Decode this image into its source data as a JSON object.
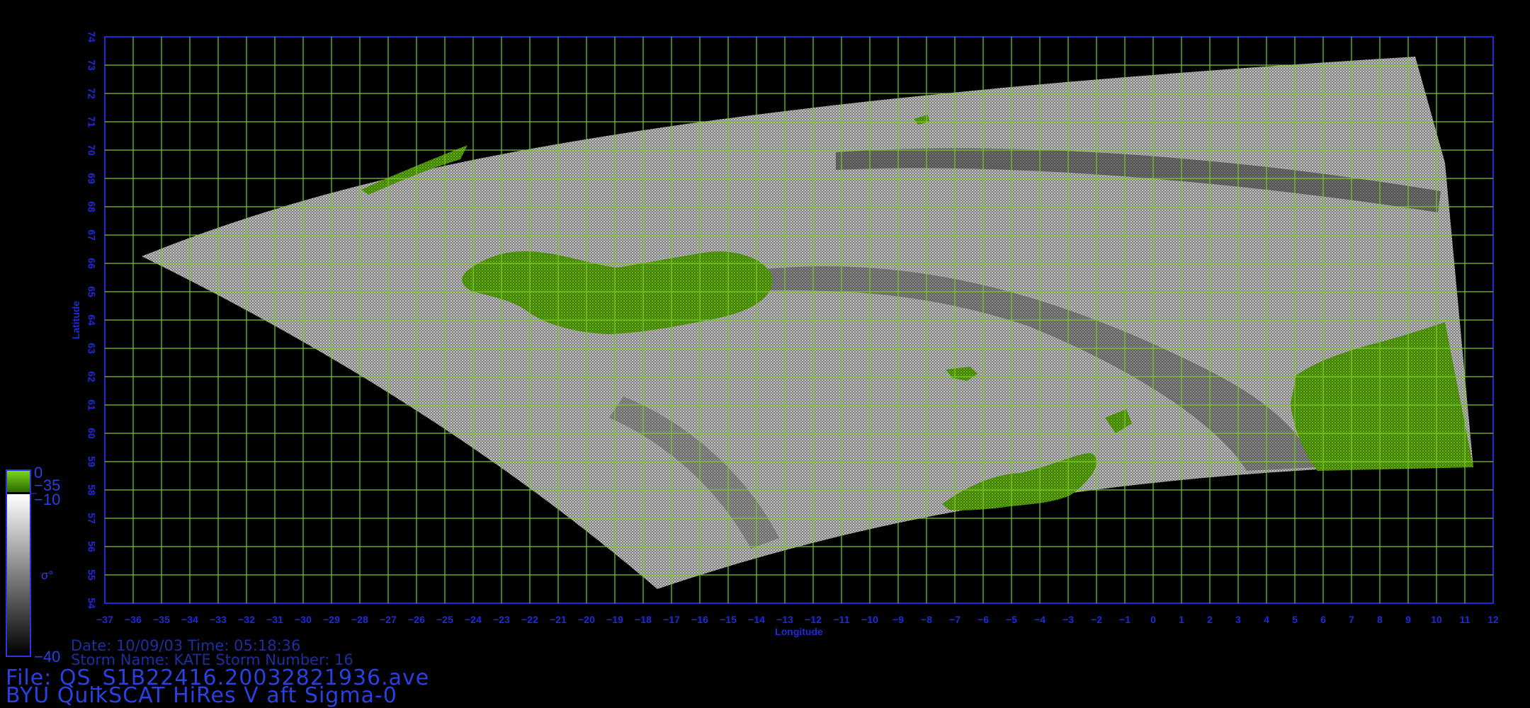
{
  "map": {
    "x_axis_label": "Longitude",
    "y_axis_label": "Latitude",
    "lon_range": [
      -37,
      12
    ],
    "lat_range": [
      54,
      74
    ],
    "lon_ticks": [
      -37,
      -36,
      -35,
      -34,
      -33,
      -32,
      -31,
      -30,
      -29,
      -28,
      -27,
      -26,
      -25,
      -24,
      -23,
      -22,
      -21,
      -20,
      -19,
      -18,
      -17,
      -16,
      -15,
      -14,
      -13,
      -12,
      -11,
      -10,
      -9,
      -8,
      -7,
      -6,
      -5,
      -4,
      -3,
      -2,
      -1,
      0,
      1,
      2,
      3,
      4,
      5,
      6,
      7,
      8,
      9,
      10,
      11,
      12
    ],
    "lat_ticks": [
      54,
      55,
      56,
      57,
      58,
      59,
      60,
      61,
      62,
      63,
      64,
      65,
      66,
      67,
      68,
      69,
      70,
      71,
      72,
      73,
      74
    ],
    "grid": true,
    "colors": {
      "background": "#000000",
      "axis": "#1f2ad8",
      "grid": "#7acc1a",
      "land": "#3f7d06",
      "land_highlight": "#5aa60c",
      "ocean_light": "#b4b4b4",
      "ocean_dark": "#555555"
    }
  },
  "colorbar": {
    "top_label": "0",
    "upper_label": "−35",
    "mid_label": "−10",
    "symbol": "σ°",
    "bottom_label": "−40"
  },
  "info": {
    "date_line": "Date: 10/09/03   Time: 05:18:36",
    "storm_line": "Storm Name: KATE   Storm Number: 16",
    "file_line": "File: QS_S1B22416.20032821936.ave",
    "product_line": "BYU QuikSCAT HiRes V aft Sigma-0"
  }
}
